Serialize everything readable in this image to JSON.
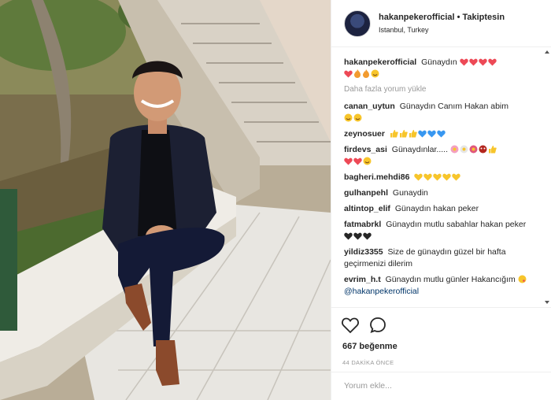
{
  "header": {
    "username": "hakanpekerofficial",
    "separator": "•",
    "follow_label": "Takiptesin",
    "location": "Istanbul, Turkey"
  },
  "caption": {
    "username": "hakanpekerofficial",
    "text": "Günaydın"
  },
  "load_more": "Daha fazla yorum yükle",
  "comments": [
    {
      "username": "canan_uytun",
      "text": "Günaydın Canım Hakan abim"
    },
    {
      "username": "zeynosuer",
      "text": ""
    },
    {
      "username": "firdevs_asi",
      "text": "Günaydınlar....."
    },
    {
      "username": "bagheri.mehdi86",
      "text": ""
    },
    {
      "username": "gulhanpehl",
      "text": "Gunaydin"
    },
    {
      "username": "altintop_elif",
      "text": "Günaydın hakan peker"
    },
    {
      "username": "fatmabrkl",
      "text": "Günaydın mutlu sabahlar hakan peker"
    },
    {
      "username": "yildiz3355",
      "text": "Size de günaydın güzel bir hafta geçirmenizi dilerim"
    },
    {
      "username": "evrim_h.t",
      "text": "Günaydın mutlu günler Hakancığım",
      "mention": "@hakanpekerofficial"
    }
  ],
  "likes_text": "667 beğenme",
  "time_text": "44 DAKİKA ÖNCE",
  "comment_input": {
    "placeholder": "Yorum ekle..."
  },
  "colors": {
    "mention": "#003569",
    "heart": "#ed4956",
    "muted": "#999999",
    "blue_heart": "#3897f0",
    "yellow": "#f7c52b"
  },
  "icons": [
    "heart-icon",
    "comment-icon",
    "more-comments-icon"
  ]
}
